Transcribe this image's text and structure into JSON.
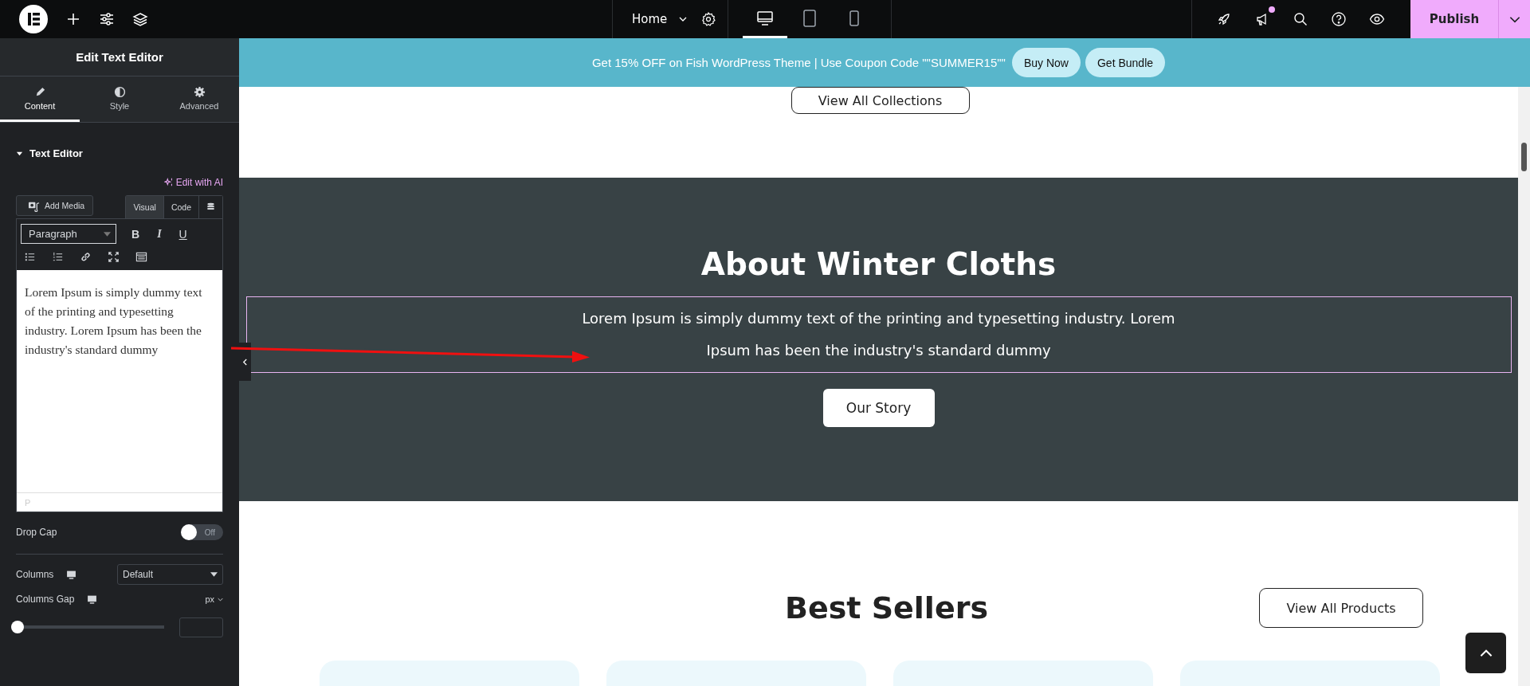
{
  "topbar": {
    "page": "Home",
    "devices": [
      {
        "kind": "desktop",
        "selected": true
      },
      {
        "kind": "tablet",
        "selected": false
      },
      {
        "kind": "mobile",
        "selected": false
      }
    ],
    "notification_dot": true,
    "publish": "Publish"
  },
  "panel": {
    "title": "Edit Text Editor",
    "tabs": [
      {
        "label": "Content",
        "selected": true
      },
      {
        "label": "Style",
        "selected": false
      },
      {
        "label": "Advanced",
        "selected": false
      }
    ],
    "section": {
      "title": "Text Editor",
      "expanded": true
    },
    "ai_link": "Edit with AI",
    "add_media": "Add Media",
    "editor_modes": [
      {
        "label": "Visual",
        "selected": true
      },
      {
        "label": "Code",
        "selected": false
      }
    ],
    "format": "Paragraph",
    "format_buttons": [
      "B",
      "I",
      "U"
    ],
    "editor_text": "Lorem Ipsum is simply dummy text of the printing and typesetting industry. Lorem Ipsum has been the industry's standard dummy",
    "editor_path": "P",
    "drop_cap": {
      "label": "Drop Cap",
      "on": false,
      "state_text": "Off"
    },
    "columns": {
      "label": "Columns",
      "value": "Default"
    },
    "columns_gap": {
      "label": "Columns Gap",
      "unit": "px",
      "level": 0
    }
  },
  "canvas": {
    "banner": {
      "text": "Get 15% OFF on Fish WordPress Theme | Use Coupon Code \"\"SUMMER15\"\"",
      "buttons": [
        "Buy Now",
        "Get Bundle"
      ]
    },
    "collections_button": "View All Collections",
    "about": {
      "heading": "About Winter Cloths",
      "text": "Lorem Ipsum is simply dummy text of the printing and typesetting industry. Lorem Ipsum has been the industry's standard dummy",
      "button": "Our Story"
    },
    "best_sellers": {
      "heading": "Best Sellers",
      "button": "View All Products"
    }
  }
}
